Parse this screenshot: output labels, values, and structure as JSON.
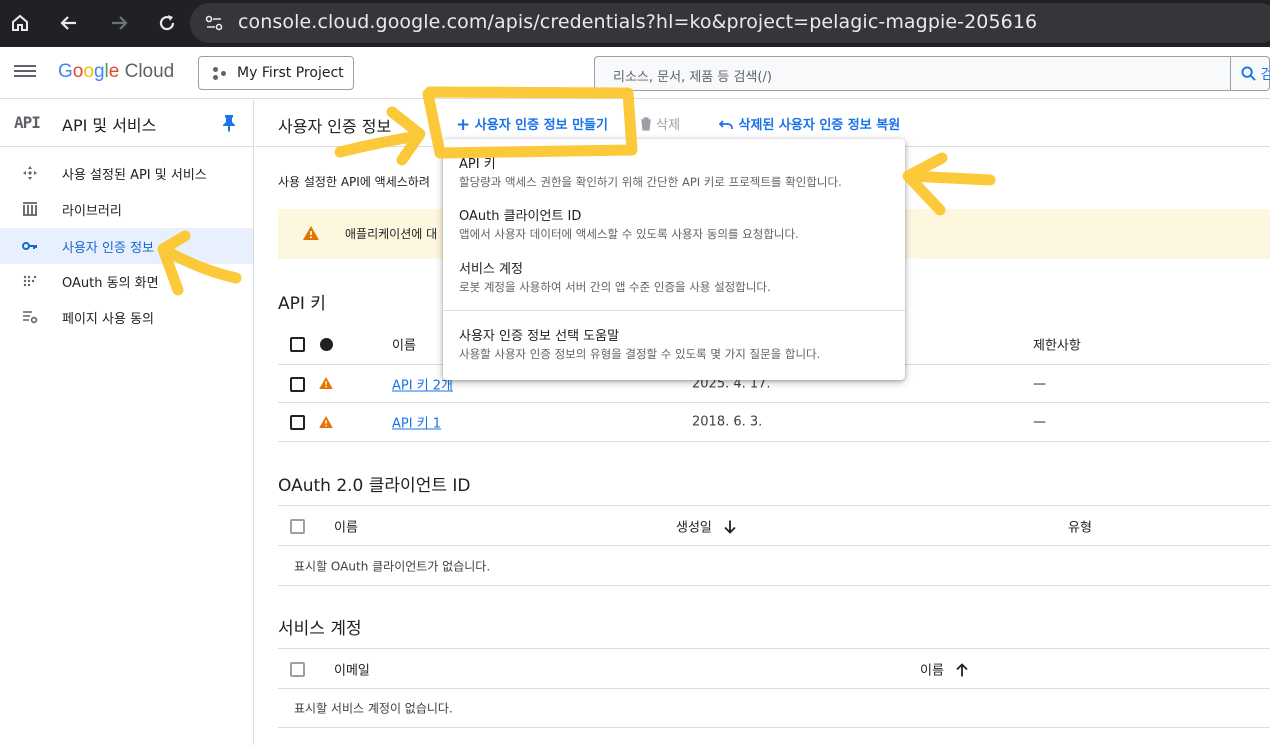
{
  "browser": {
    "url": "console.cloud.google.com/apis/credentials?hl=ko&project=pelagic-magpie-205616"
  },
  "header": {
    "logo_google": [
      "G",
      "o",
      "o",
      "g",
      "l",
      "e"
    ],
    "logo_cloud": "Cloud",
    "project": "My First Project",
    "search_placeholder": "리소스, 문서, 제품 등 검색(/)",
    "search_button": "검색"
  },
  "sidebar": {
    "api_mark": "API",
    "title": "API 및 서비스",
    "items": [
      {
        "label": "사용 설정된 API 및 서비스",
        "icon": "diamond-arrows-icon"
      },
      {
        "label": "라이브러리",
        "icon": "library-icon"
      },
      {
        "label": "사용자 인증 정보",
        "icon": "key-icon",
        "active": true
      },
      {
        "label": "OAuth 동의 화면",
        "icon": "dots-grid-icon"
      },
      {
        "label": "페이지 사용 동의",
        "icon": "settings-list-icon"
      }
    ]
  },
  "toolbar": {
    "title": "사용자 인증 정보",
    "create": "사용자 인증 정보 만들기",
    "delete": "삭제",
    "restore": "삭제된 사용자 인증 정보 복원"
  },
  "main": {
    "description": "사용 설정한 API에 액세스하려",
    "warning": "애플리케이션에 대",
    "api_keys": {
      "title": "API 키",
      "headers": {
        "name": "이름",
        "restrictions": "제한사항"
      },
      "rows": [
        {
          "name": "API 키 2개",
          "date": "2025. 4. 17.",
          "restriction": "—"
        },
        {
          "name": "API 키 1",
          "date": "2018. 6. 3.",
          "restriction": "—"
        }
      ]
    },
    "oauth": {
      "title": "OAuth 2.0 클라이언트 ID",
      "headers": {
        "name": "이름",
        "created": "생성일",
        "type": "유형"
      },
      "empty": "표시할 OAuth 클라이언트가 없습니다."
    },
    "service_accounts": {
      "title": "서비스 계정",
      "headers": {
        "email": "이메일",
        "name": "이름"
      },
      "empty": "표시할 서비스 계정이 없습니다."
    }
  },
  "dropdown": {
    "items": [
      {
        "title": "API 키",
        "subtitle": "할당량과 액세스 권한을 확인하기 위해 간단한 API 키로 프로젝트를 확인합니다."
      },
      {
        "title": "OAuth 클라이언트 ID",
        "subtitle": "앱에서 사용자 데이터에 액세스할 수 있도록 사용자 동의를 요청합니다."
      },
      {
        "title": "서비스 계정",
        "subtitle": "로봇 계정을 사용하여 서버 간의 앱 수준 인증을 사용 설정합니다."
      },
      {
        "title": "사용자 인증 정보 선택 도움말",
        "subtitle": "사용할 사용자 인증 정보의 유형을 결정할 수 있도록 몇 가지 질문을 합니다."
      }
    ]
  },
  "colors": {
    "accent": "#1a73e8",
    "annotation": "#fbc62f",
    "warning": "#e37400"
  }
}
